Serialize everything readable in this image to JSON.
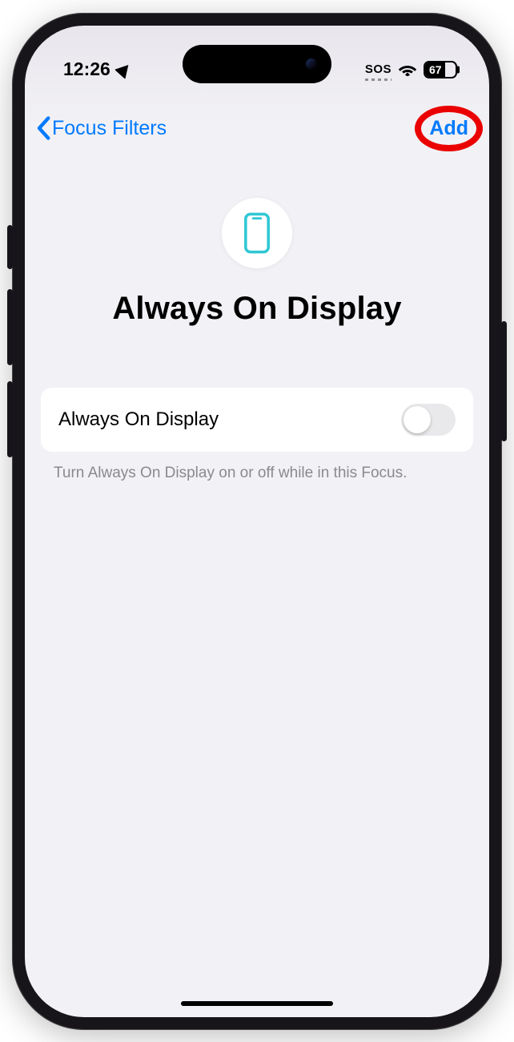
{
  "status": {
    "time": "12:26",
    "sos": "SOS",
    "battery": "67"
  },
  "nav": {
    "back_label": "Focus Filters",
    "add_label": "Add"
  },
  "header": {
    "title": "Always On Display",
    "icon": "phone-outline-icon"
  },
  "setting": {
    "label": "Always On Display",
    "enabled": false
  },
  "footer": "Turn Always On Display on or off while in this Focus.",
  "colors": {
    "tint": "#007aff",
    "background": "#f2f1f5",
    "annotation": "#ea0000"
  }
}
